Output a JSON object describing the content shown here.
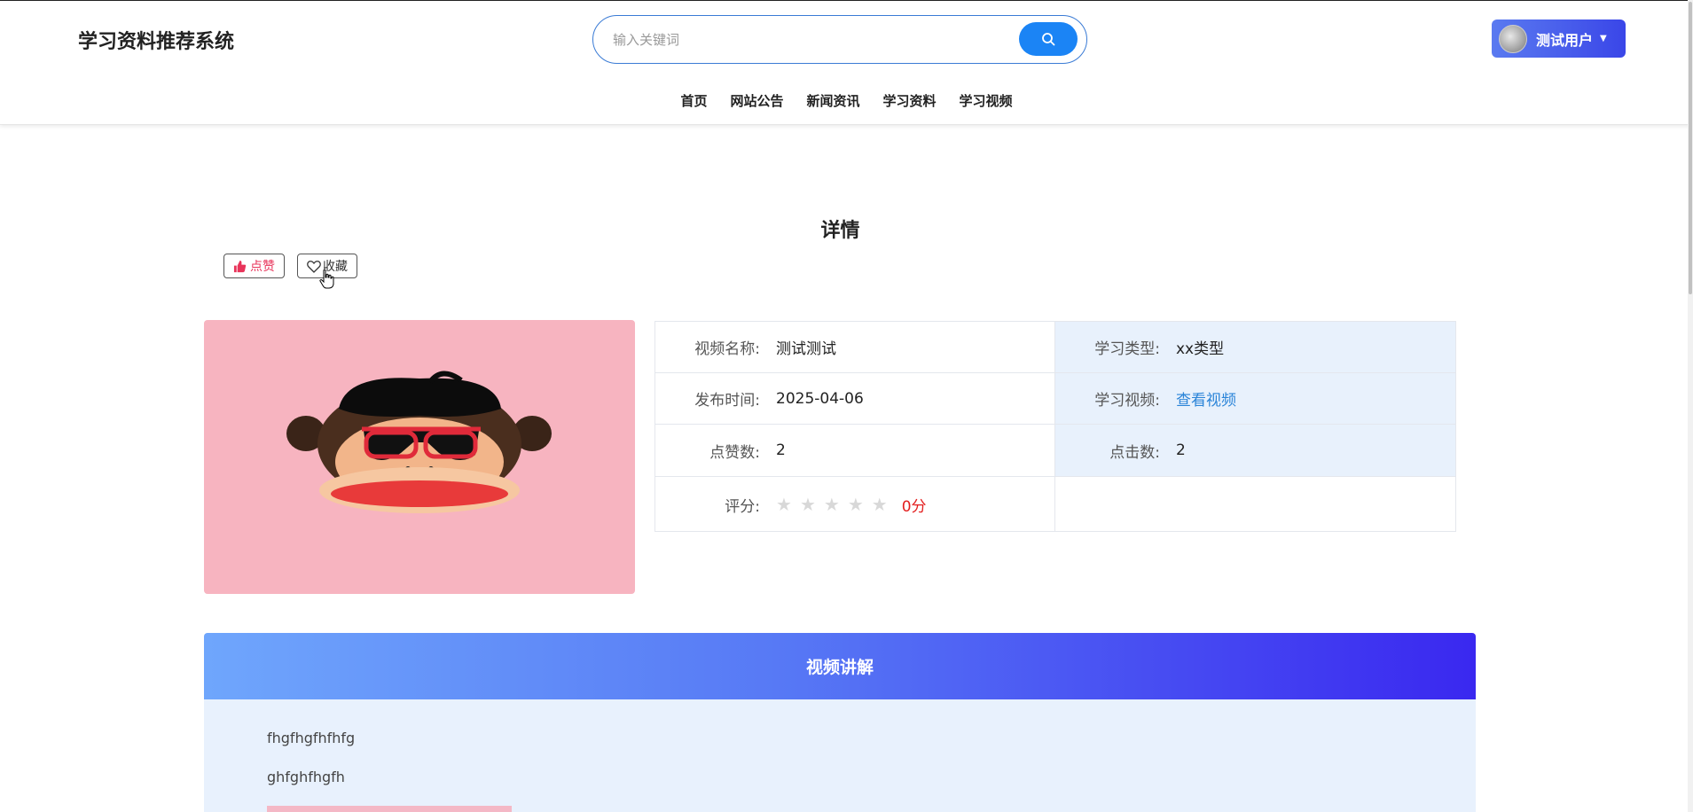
{
  "header": {
    "brand": "学习资料推荐系统",
    "search_placeholder": "输入关键词",
    "user_name": "测试用户"
  },
  "nav": [
    "首页",
    "网站公告",
    "新闻资讯",
    "学习资料",
    "学习视频"
  ],
  "detail": {
    "title": "详情",
    "like_label": "点赞",
    "favorite_label": "收藏",
    "fields": {
      "video_name_label": "视频名称:",
      "video_name": "测试测试",
      "study_type_label": "学习类型:",
      "study_type": "xx类型",
      "publish_time_label": "发布时间:",
      "publish_time": "2025-04-06",
      "study_video_label": "学习视频:",
      "study_video_link": "查看视频",
      "likes_label": "点赞数:",
      "likes": "2",
      "clicks_label": "点击数:",
      "clicks": "2",
      "rating_label": "评分:",
      "rating_score": "0分",
      "rating_stars": 0
    }
  },
  "explain": {
    "title": "视频讲解",
    "paragraphs": [
      "fhgfhgfhfhfg",
      "ghfghfhgfh"
    ]
  }
}
